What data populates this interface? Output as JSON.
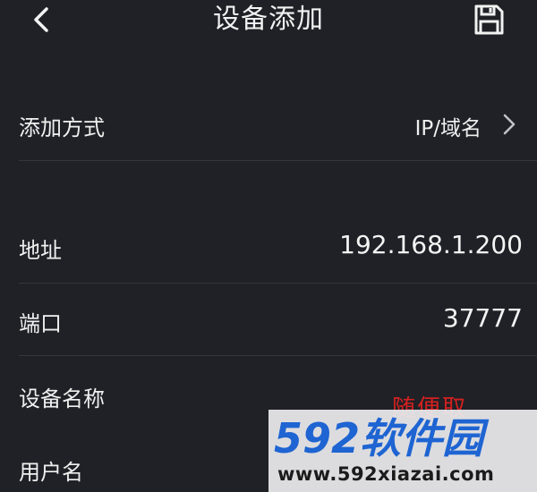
{
  "header": {
    "title": "设备添加",
    "back_icon": "chevron-left-icon",
    "save_icon": "save-icon"
  },
  "form": {
    "add_method": {
      "label": "添加方式",
      "value": "IP/域名"
    },
    "address": {
      "label": "地址",
      "value": "192.168.1.200"
    },
    "port": {
      "label": "端口",
      "value": "37777"
    },
    "device_name": {
      "label": "设备名称",
      "hint": "随便取"
    },
    "username": {
      "label": "用户名"
    }
  },
  "watermark": {
    "logo_text": "592软件园",
    "url": "www.592xiazai.com"
  },
  "colors": {
    "background": "#1f2126",
    "text": "#f0f0f0",
    "hint_red": "#d42020",
    "watermark_blue": "#1e64d2"
  }
}
